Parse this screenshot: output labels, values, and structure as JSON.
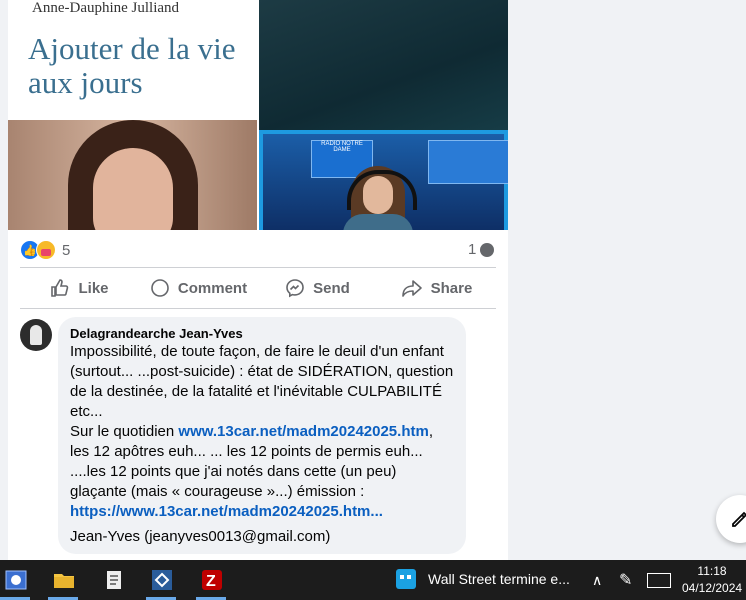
{
  "post": {
    "image_left": {
      "author": "Anne-Dauphine Julliand",
      "title": "Ajouter de la vie aux jours"
    },
    "image_right": {
      "screen_text": "RADIO NOTRE DAME"
    },
    "reactions": {
      "count": "5"
    },
    "comments_count": "1",
    "actions": [
      {
        "label": "Like",
        "icon": "thumbs-up-icon"
      },
      {
        "label": "Comment",
        "icon": "comment-bubble-icon"
      },
      {
        "label": "Send",
        "icon": "messenger-icon"
      },
      {
        "label": "Share",
        "icon": "share-arrow-icon"
      }
    ]
  },
  "comment": {
    "author": "Delagrandearche Jean-Yves",
    "line1": "Impossibilité, de toute façon, de faire le deuil d'un enfant (surtout... ...post-suicide) : état de SIDÉRATION, question de la destinée, de la fatalité et l'inévitable CULPABILITÉ etc...",
    "line2_prefix": "Sur le quotidien ",
    "link1": "www.13car.net/madm20242025.htm",
    "line2_suffix": ", les 12 apôtres euh... ... les 12 points de permis euh... ....les 12 points que j'ai notés dans cette (un peu) glaçante (mais « courageuse »...) émission :",
    "link2": "https://www.13car.net/madm20242025.htm...",
    "signature": "Jean-Yves (jeanyves0013@gmail.com)"
  },
  "taskbar": {
    "news": "Wall Street termine e...",
    "time": "11:18",
    "date": "04/12/2024"
  }
}
